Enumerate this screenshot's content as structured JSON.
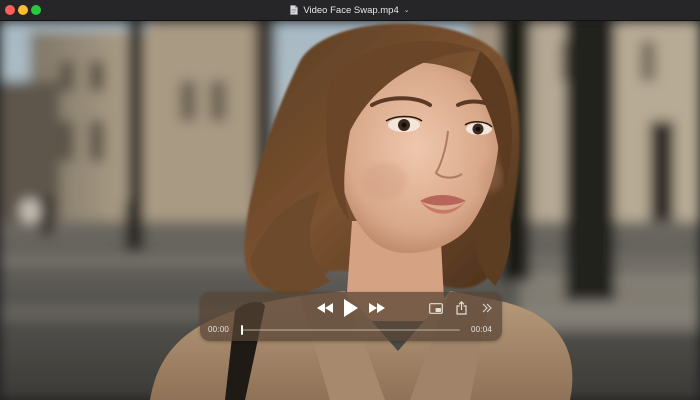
{
  "window": {
    "title": "Video Face Swap.mp4",
    "title_icon": "document-icon",
    "title_chevron": "⌄"
  },
  "video": {
    "description_icon": "video-frame"
  },
  "player": {
    "current_time": "00:00",
    "total_time": "00:04",
    "progress": 0.0,
    "buttons": {
      "rewind": "rewind-icon",
      "play": "play-icon",
      "forward": "fast-forward-icon",
      "pip": "picture-in-picture-icon",
      "share": "share-icon",
      "more": "more-chevrons-icon"
    }
  }
}
